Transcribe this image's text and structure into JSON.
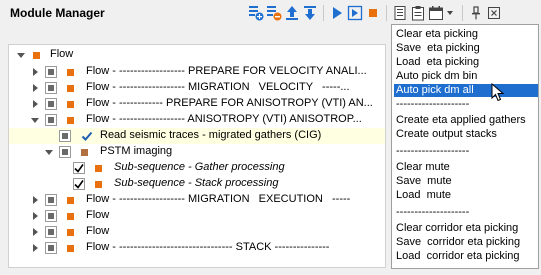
{
  "app": {
    "title": "Module Manager"
  },
  "toolbar": {
    "icons": [
      "add-module-icon",
      "remove-module-icon",
      "move-up-icon",
      "move-down-icon",
      "run-icon",
      "run-step-icon",
      "stop-icon",
      "document-icon",
      "clipboard-icon",
      "calendar-icon",
      "dropdown-arrow-icon",
      "pin-icon",
      "close-window-icon"
    ],
    "accent": "#1f6fd0",
    "stop_color": "#e8700d"
  },
  "tree": {
    "rows": [
      {
        "label": "Flow"
      },
      {
        "label": "Flow - ------------------ PREPARE FOR VELOCITY ANALI..."
      },
      {
        "label": "Flow - ------------------ MIGRATION   VELOCITY   -----..."
      },
      {
        "label": "Flow - ------------ PREPARE FOR ANISOTROPY (VTI) AN..."
      },
      {
        "label": "Flow - ------------------ ANISOTROPY (VTI) ANISOTROP..."
      },
      {
        "label": "Read seismic traces - migrated gathers (CIG)"
      },
      {
        "label": "PSTM imaging"
      },
      {
        "label": "Sub-sequence - Gather processing"
      },
      {
        "label": "Sub-sequence - Stack processing"
      },
      {
        "label": "Flow - ------------------ MIGRATION   EXECUTION   -----"
      },
      {
        "label": "Flow"
      },
      {
        "label": "Flow"
      },
      {
        "label": "Flow - ------------------------------- STACK ---------------"
      }
    ],
    "colors": {
      "module": "#e8700d",
      "module_dim": "#b07040",
      "highlight": "#ffffe1",
      "check": "#1f5fb0"
    }
  },
  "context_menu": {
    "items": [
      "Clear eta picking",
      "Save  eta picking",
      "Load  eta picking",
      "Auto pick dm bin",
      "Auto pick dm all",
      "--------------------",
      "Create eta applied gathers",
      "Create output stacks",
      "--------------------",
      "Clear mute",
      "Save  mute",
      "Load  mute",
      "--------------------",
      "Clear corridor eta picking",
      "Save  corridor eta picking",
      "Load  corridor eta picking"
    ],
    "selected_index": 4,
    "selected_color": "#1e6ed0"
  }
}
